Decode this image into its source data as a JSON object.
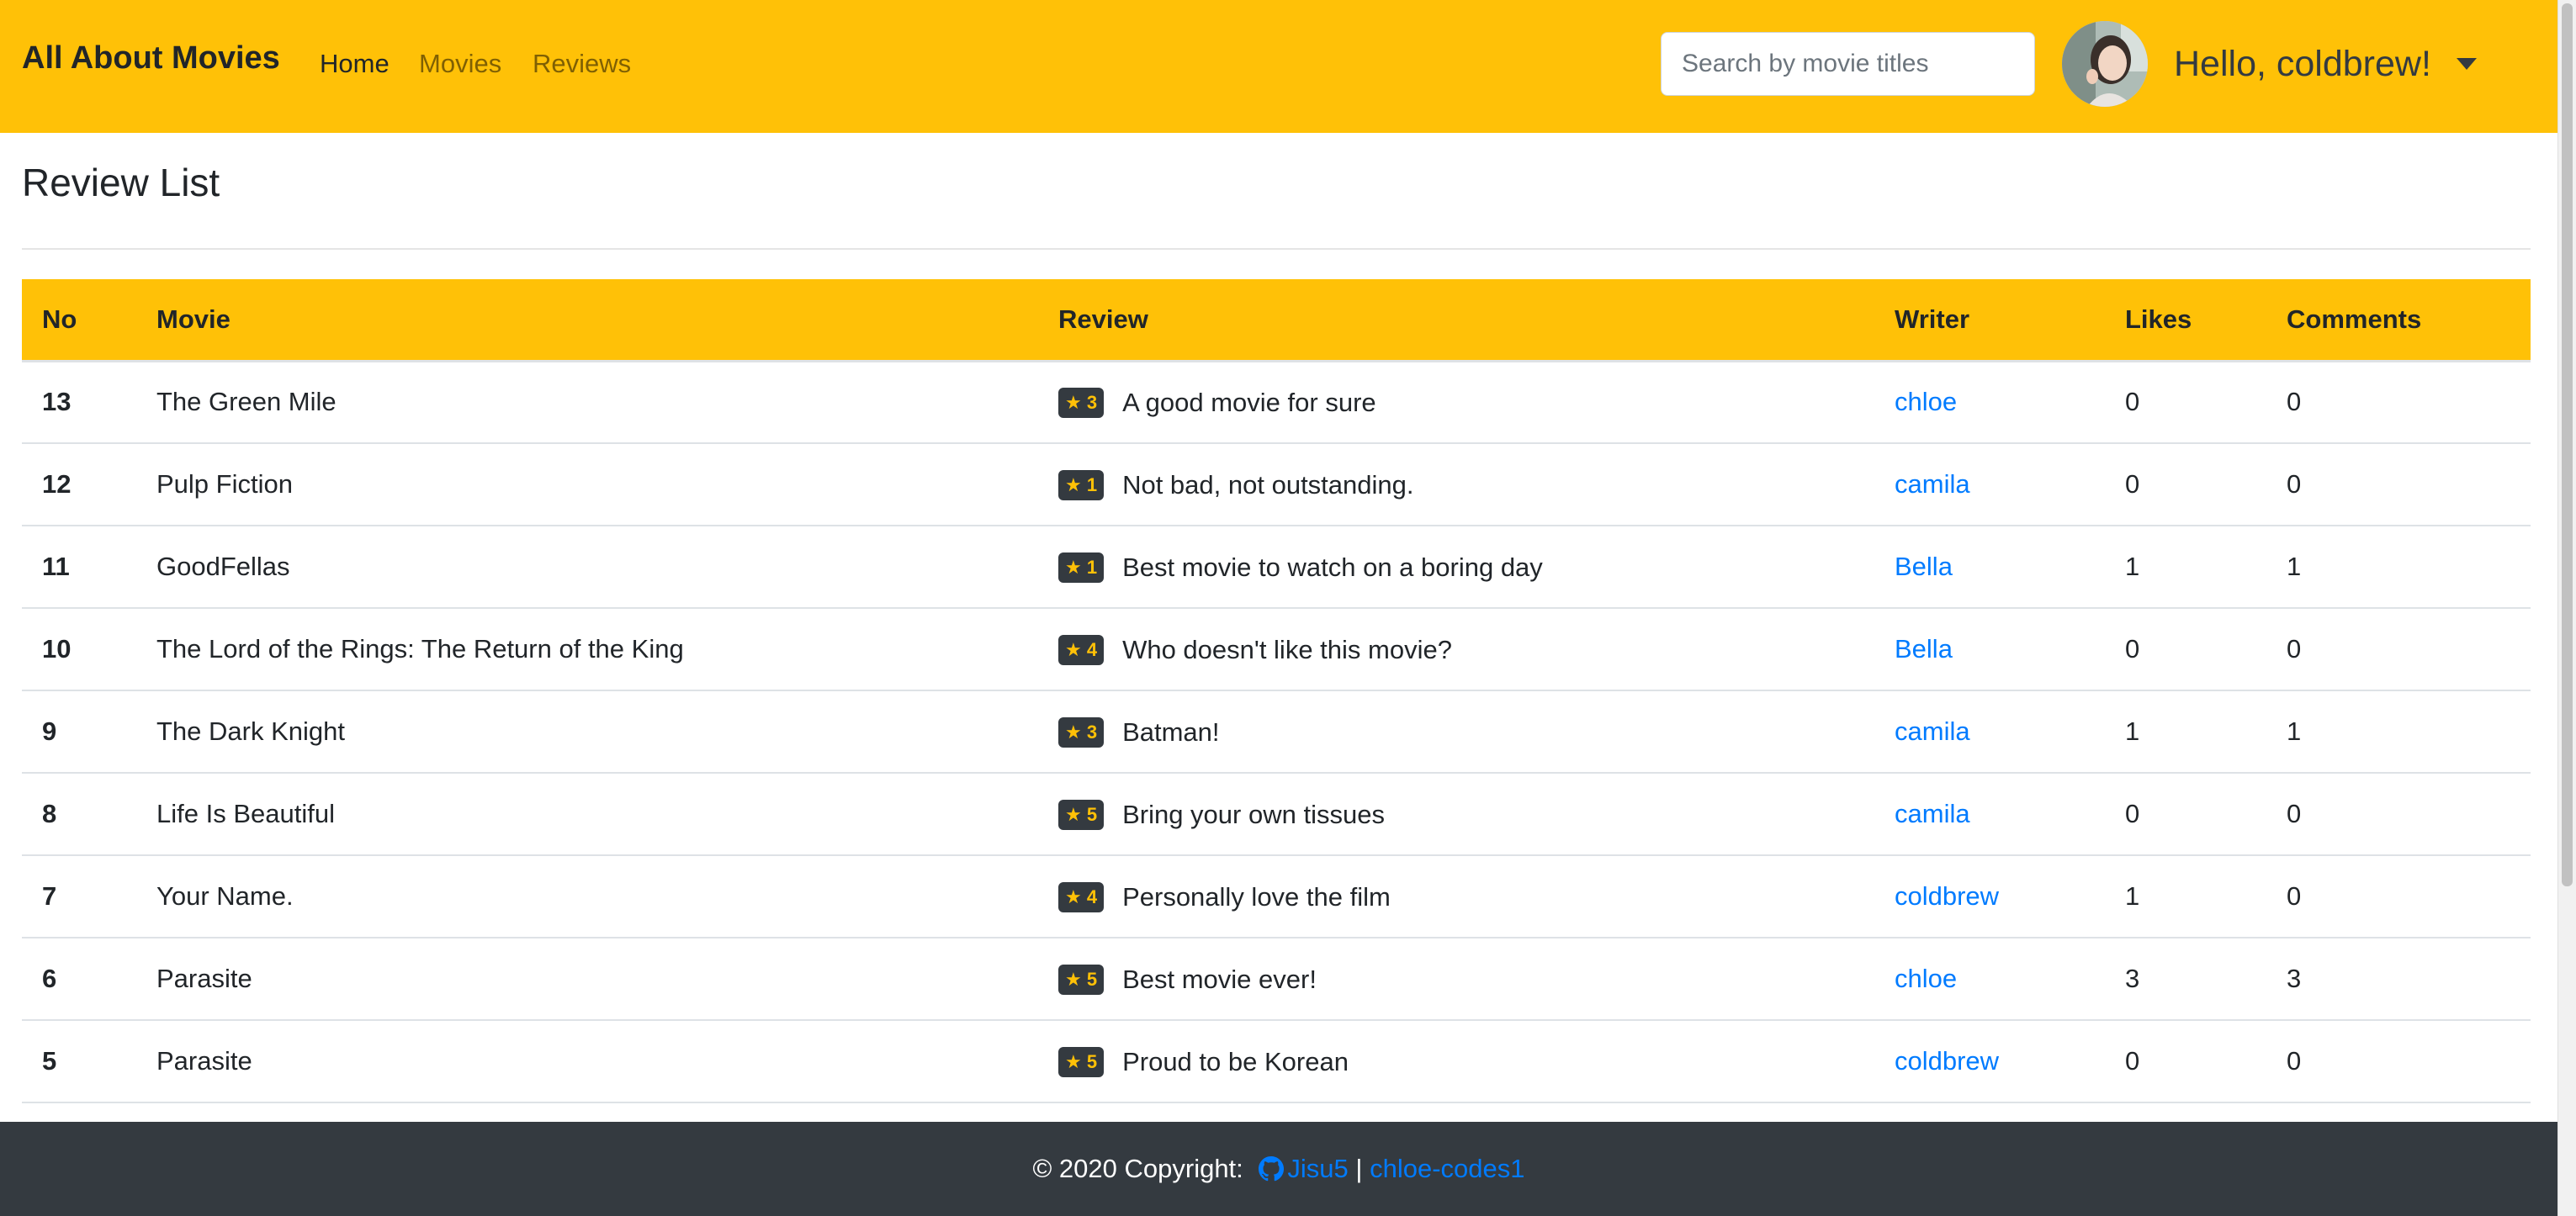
{
  "navbar": {
    "brand": "All About Movies",
    "links": [
      {
        "label": "Home",
        "active": true
      },
      {
        "label": "Movies",
        "active": false
      },
      {
        "label": "Reviews",
        "active": false
      }
    ],
    "search_placeholder": "Search by movie titles",
    "greeting": "Hello, coldbrew!"
  },
  "page": {
    "title": "Review List"
  },
  "table": {
    "headers": [
      "No",
      "Movie",
      "Review",
      "Writer",
      "Likes",
      "Comments"
    ],
    "rows": [
      {
        "no": "13",
        "movie": "The Green Mile",
        "rating": "★ 3",
        "review": "A good movie for sure",
        "writer": "chloe",
        "likes": "0",
        "comments": "0"
      },
      {
        "no": "12",
        "movie": "Pulp Fiction",
        "rating": "★ 1",
        "review": "Not bad, not outstanding.",
        "writer": "camila",
        "likes": "0",
        "comments": "0"
      },
      {
        "no": "11",
        "movie": "GoodFellas",
        "rating": "★ 1",
        "review": "Best movie to watch on a boring day",
        "writer": "Bella",
        "likes": "1",
        "comments": "1"
      },
      {
        "no": "10",
        "movie": "The Lord of the Rings: The Return of the King",
        "rating": "★ 4",
        "review": "Who doesn't like this movie?",
        "writer": "Bella",
        "likes": "0",
        "comments": "0"
      },
      {
        "no": "9",
        "movie": "The Dark Knight",
        "rating": "★ 3",
        "review": "Batman!",
        "writer": "camila",
        "likes": "1",
        "comments": "1"
      },
      {
        "no": "8",
        "movie": "Life Is Beautiful",
        "rating": "★ 5",
        "review": "Bring your own tissues",
        "writer": "camila",
        "likes": "0",
        "comments": "0"
      },
      {
        "no": "7",
        "movie": "Your Name.",
        "rating": "★ 4",
        "review": "Personally love the film",
        "writer": "coldbrew",
        "likes": "1",
        "comments": "0"
      },
      {
        "no": "6",
        "movie": "Parasite",
        "rating": "★ 5",
        "review": "Best movie ever!",
        "writer": "chloe",
        "likes": "3",
        "comments": "3"
      },
      {
        "no": "5",
        "movie": "Parasite",
        "rating": "★ 5",
        "review": "Proud to be Korean",
        "writer": "coldbrew",
        "likes": "0",
        "comments": "0"
      }
    ]
  },
  "footer": {
    "copyright": "© 2020 Copyright:",
    "github_icon": "github-icon",
    "link1": "Jisu5",
    "separator": "|",
    "link2": "chloe-codes1"
  },
  "colors": {
    "navbar_bg": "#ffc107",
    "footer_bg": "#343a40",
    "link": "#007bff",
    "badge_bg": "#343a40",
    "badge_star": "#ffc107"
  }
}
